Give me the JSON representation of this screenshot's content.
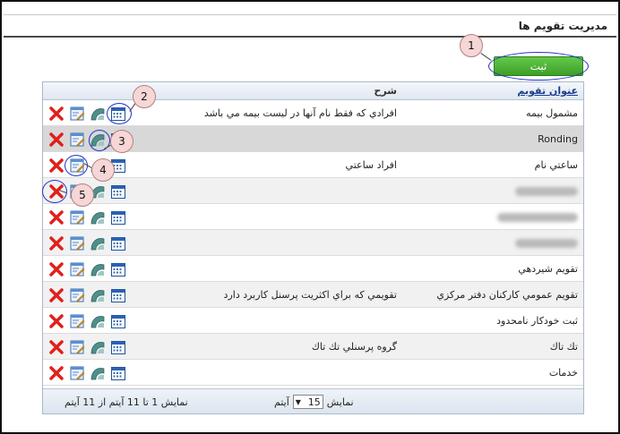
{
  "page": {
    "title": "مديريت تقويم ها",
    "save_label": "ثبت"
  },
  "grid": {
    "col_title": "عنوان تقويم",
    "col_desc": "شرح",
    "rows": [
      {
        "title": "مشمول بيمه",
        "desc": "افرادي كه فقط نام آنها در ليست بيمه مي باشد",
        "blurred": false
      },
      {
        "title": "Ronding",
        "desc": "",
        "blurred": false
      },
      {
        "title": "ساعتي نام",
        "desc": "افراد ساعتي",
        "blurred": false
      },
      {
        "title": "",
        "desc": "",
        "blurred": true
      },
      {
        "title": "",
        "desc": "",
        "blurred": true
      },
      {
        "title": "",
        "desc": "",
        "blurred": true
      },
      {
        "title": "تقويم شيردهي",
        "desc": "",
        "blurred": false
      },
      {
        "title": "تقويم عمومي كاركنان دفتر مركزي",
        "desc": "تقويمي كه براي اكثريت پرسنل كاربرد دارد",
        "blurred": false
      },
      {
        "title": "ثبت خودكار نامحدود",
        "desc": "",
        "blurred": false
      },
      {
        "title": "تك تاك",
        "desc": "گروه پرسنلي تك تاك",
        "blurred": false
      },
      {
        "title": "خدمات",
        "desc": "",
        "blurred": false
      }
    ],
    "footer": {
      "range_text": "نمايش 1 تا 11 آيتم از 11 آيتم",
      "show_label": "نمايش",
      "page_size": "15",
      "items_label": "آيتم"
    }
  },
  "callouts": [
    "1",
    "2",
    "3",
    "4",
    "5"
  ],
  "icons": {
    "delete": "delete-x-icon",
    "edit": "edit-icon",
    "assign": "assign-icon",
    "calendar": "calendar-icon"
  },
  "colors": {
    "save_button": "#4caf34",
    "delete_icon": "#e0201b",
    "link_blue": "#1a3d8f",
    "callout_ring": "#2233cc"
  }
}
